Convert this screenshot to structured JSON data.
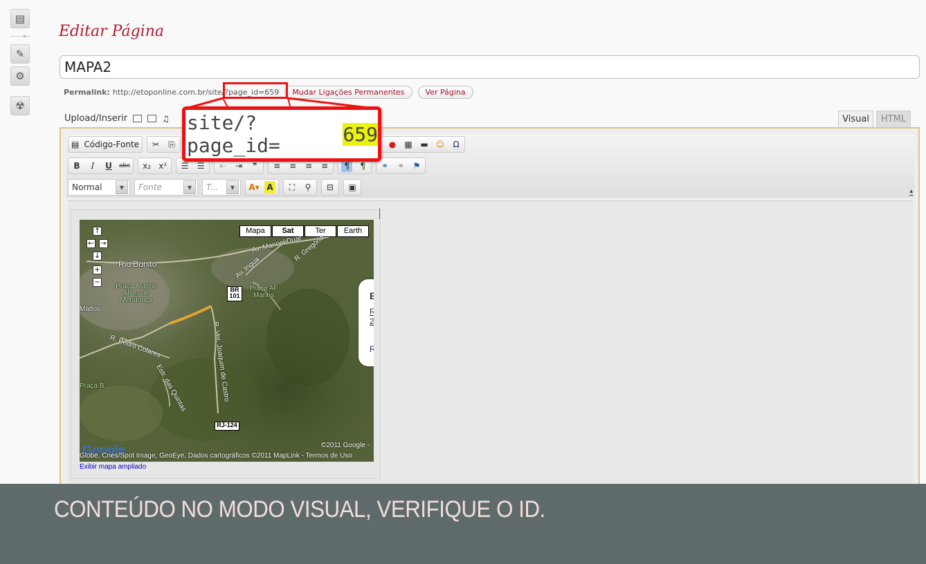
{
  "page": {
    "title": "Editar Página"
  },
  "post_title": {
    "value": "MAPA2"
  },
  "permalink": {
    "label": "Permalink:",
    "url": "http://etoponline.com.br/site/?page_id=659",
    "change_button": "Mudar Ligações Permanentes",
    "view_button": "Ver Página"
  },
  "upload": {
    "label": "Upload/Inserir"
  },
  "editor_tabs": {
    "visual": "Visual",
    "html": "HTML"
  },
  "toolbar": {
    "source_button": "Código-Fonte",
    "format_value": "Normal",
    "font_placeholder": "Fonte",
    "size_placeholder": "T..."
  },
  "map": {
    "types": [
      "Mapa",
      "Sat",
      "Ter",
      "Earth"
    ],
    "active_type": "Sat",
    "places": {
      "rio_bonito": "Rio Bonito",
      "praca_asterio": "Praça Astério Alves de Mendonça",
      "praca_af": "Praça AF Marins",
      "mattos": "Mattos",
      "praca_b": "Praça B."
    },
    "roads": {
      "manoel": "Av. Manoel Duar",
      "gregorio": "R. Gregório",
      "ingua": "Av. Ingua",
      "pedro_colares": "R. Pedro Colares",
      "ver_joaquim": "R. Ver. Joaquim de Castro",
      "estr_das_quintas": "Estr. das Quintas"
    },
    "shields": {
      "br": "BR",
      "br_num": "101",
      "rj": "RJ-124"
    },
    "infowindow": {
      "title": "B",
      "line1": "R",
      "line2": "2",
      "line3": "R"
    },
    "copyright": "©2011 Google -",
    "attribution": "Globe, Cnes/Spot Image, GeoEye, Dados cartográficos ©2011 MapLink - Termos de Uso",
    "logo": "Google",
    "view_larger": "Exibir mapa ampliado"
  },
  "callout": {
    "prefix": "site/?page_id=",
    "id": "659"
  },
  "footer": {
    "text": "CONTEÚDO NO MODO VISUAL, VERIFIQUE O ID."
  },
  "colors": {
    "title": "#b01c2e",
    "highlight": "#eaf20e",
    "callout_border": "#ee1111",
    "footer_bg": "#5f6b6a"
  },
  "icons": [
    "pages-icon",
    "plugins-icon",
    "tools-icon",
    "settings-icon"
  ]
}
